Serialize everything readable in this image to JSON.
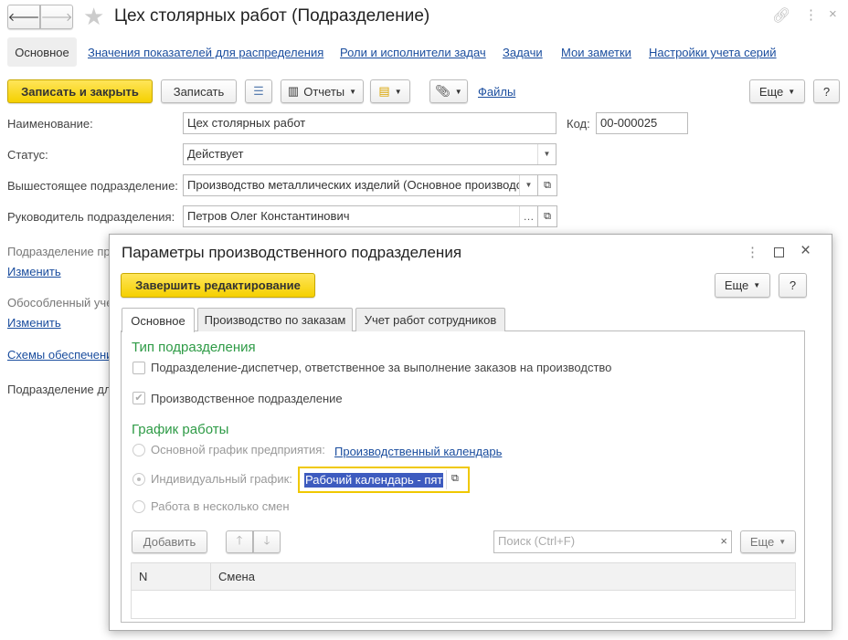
{
  "window": {
    "title": "Цех столярных работ (Подразделение)"
  },
  "tabs": [
    "Основное",
    "Значения показателей для распределения",
    "Роли и исполнители задач",
    "Задачи",
    "Мои заметки",
    "Настройки учета серий"
  ],
  "toolbar": {
    "save_close": "Записать и закрыть",
    "save": "Записать",
    "reports": "Отчеты",
    "files": "Файлы",
    "more": "Еще",
    "help": "?"
  },
  "form": {
    "name_label": "Наименование:",
    "name_value": "Цех столярных работ",
    "code_label": "Код:",
    "code_value": "00-000025",
    "status_label": "Статус:",
    "status_value": "Действует",
    "parent_label": "Вышестоящее подразделение:",
    "parent_value": "Производство металлических изделий (Основное производство)",
    "head_label": "Руководитель подразделения:",
    "head_value": "Петров Олег Константинович",
    "prod_label": "Подразделение пр",
    "change1": "Изменить",
    "separate_label": "Обособленный уче",
    "change2": "Изменить",
    "schemes_link": "Схемы обеспечени",
    "for_label": "Подразделение дл"
  },
  "dialog": {
    "title": "Параметры производственного подразделения",
    "finish": "Завершить редактирование",
    "more": "Еще",
    "help": "?",
    "tabs": [
      "Основное",
      "Производство по заказам",
      "Учет работ сотрудников"
    ],
    "type_heading": "Тип подразделения",
    "dispatcher": "Подразделение-диспетчер, ответственное за выполнение заказов на производство",
    "production": "Производственное подразделение",
    "schedule_heading": "График работы",
    "main_schedule": "Основной график предприятия:",
    "main_schedule_link": "Производственный календарь",
    "individual": "Индивидуальный график:",
    "individual_value": "Рабочий календарь - пяти",
    "shifts": "Работа в несколько смен",
    "add": "Добавить",
    "search_placeholder": "Поиск (Ctrl+F)",
    "table_more": "Еще",
    "columns": [
      "N",
      "Смена"
    ]
  }
}
